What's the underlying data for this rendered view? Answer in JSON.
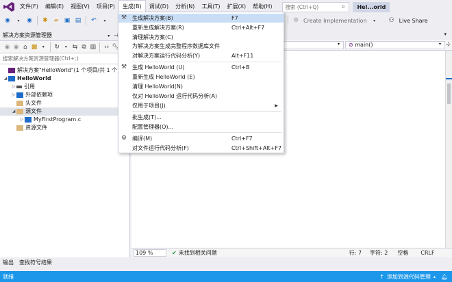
{
  "menubar": {
    "items": [
      "文件(F)",
      "编辑(E)",
      "视图(V)",
      "项目(P)",
      "生成(B)",
      "调试(D)",
      "分析(N)",
      "工具(T)",
      "扩展(X)",
      "帮助(H)"
    ],
    "search_placeholder": "搜索 (Ctrl+Q)",
    "solution_title": "Hel...orld"
  },
  "toolbar": {
    "create_implementation": "Create Implementation",
    "live_share": "Live Share"
  },
  "solution_explorer": {
    "title": "解决方案资源管理器",
    "search_placeholder": "搜索解决方案资源管理器(Ctrl+;)",
    "tree": [
      {
        "label": "解决方案\"HelloWorld\"(1 个项目/共 1 个)",
        "indent": 0,
        "arrow": "",
        "icon": "solution-icon",
        "bold": false
      },
      {
        "label": "HelloWorld",
        "indent": 0,
        "arrow": "◢",
        "icon": "project-icon",
        "bold": true
      },
      {
        "label": "引用",
        "indent": 1,
        "arrow": "▷",
        "icon": "references-icon",
        "bold": false
      },
      {
        "label": "外部依赖项",
        "indent": 1,
        "arrow": "▷",
        "icon": "external-deps-icon",
        "bold": false
      },
      {
        "label": "头文件",
        "indent": 1,
        "arrow": "",
        "icon": "folder-icon",
        "bold": false
      },
      {
        "label": "源文件",
        "indent": 1,
        "arrow": "◢",
        "icon": "folder-open-icon",
        "bold": false
      },
      {
        "label": "MyFirstProgram.c",
        "indent": 2,
        "arrow": "▷",
        "icon": "c-file-icon",
        "bold": false
      },
      {
        "label": "资源文件",
        "indent": 1,
        "arrow": "",
        "icon": "folder-icon",
        "bold": false
      }
    ]
  },
  "build_menu": {
    "items": [
      {
        "label": "生成解决方案(B)",
        "shortcut": "F7",
        "icon": "build-solution-icon",
        "highlighted": true
      },
      {
        "label": "重新生成解决方案(R)",
        "shortcut": "Ctrl+Alt+F7",
        "icon": "",
        "highlighted": false
      },
      {
        "label": "清理解决方案(C)",
        "shortcut": "",
        "icon": "",
        "highlighted": false
      },
      {
        "label": "为解决方案生成完整程序数据库文件",
        "shortcut": "",
        "icon": "",
        "highlighted": false
      },
      {
        "label": "对解决方案运行代码分析(Y)",
        "shortcut": "Alt+F11",
        "icon": "",
        "highlighted": false
      },
      {
        "label": "生成 HelloWorld (U)",
        "shortcut": "Ctrl+B",
        "icon": "build-project-icon",
        "highlighted": false
      },
      {
        "label": "重新生成 HelloWorld (E)",
        "shortcut": "",
        "icon": "",
        "highlighted": false
      },
      {
        "label": "清理 HelloWorld(N)",
        "shortcut": "",
        "icon": "",
        "highlighted": false
      },
      {
        "label": "仅对 HelloWorld 运行代码分析(A)",
        "shortcut": "",
        "icon": "",
        "highlighted": false
      },
      {
        "label": "仅用于项目(J)",
        "shortcut": "",
        "icon": "",
        "highlighted": false,
        "submenu": true
      },
      {
        "label": "批生成(T)...",
        "shortcut": "",
        "icon": "",
        "highlighted": false
      },
      {
        "label": "配置管理器(O)...",
        "shortcut": "",
        "icon": "",
        "highlighted": false
      },
      {
        "label": "编译(M)",
        "shortcut": "Ctrl+F7",
        "icon": "compile-icon",
        "highlighted": false
      },
      {
        "label": "对文件运行代码分析(F)",
        "shortcut": "Ctrl+Shift+Alt+F7",
        "icon": "",
        "highlighted": false
      }
    ]
  },
  "editor": {
    "function_combo": "main()"
  },
  "editor_status": {
    "zoom": "109 %",
    "issues": "未找到相关问题",
    "line": "行: 7",
    "char": "字符: 2",
    "whitespace": "空格",
    "line_ending": "CRLF"
  },
  "bottom_tabs": [
    "输出",
    "查找符号结果"
  ],
  "statusbar": {
    "ready": "就绪",
    "source_control": "添加到源代码管理"
  },
  "colors": {
    "accent": "#1c97ea",
    "menu_highlight": "#c9def5",
    "vs_purple": "#68217a"
  }
}
